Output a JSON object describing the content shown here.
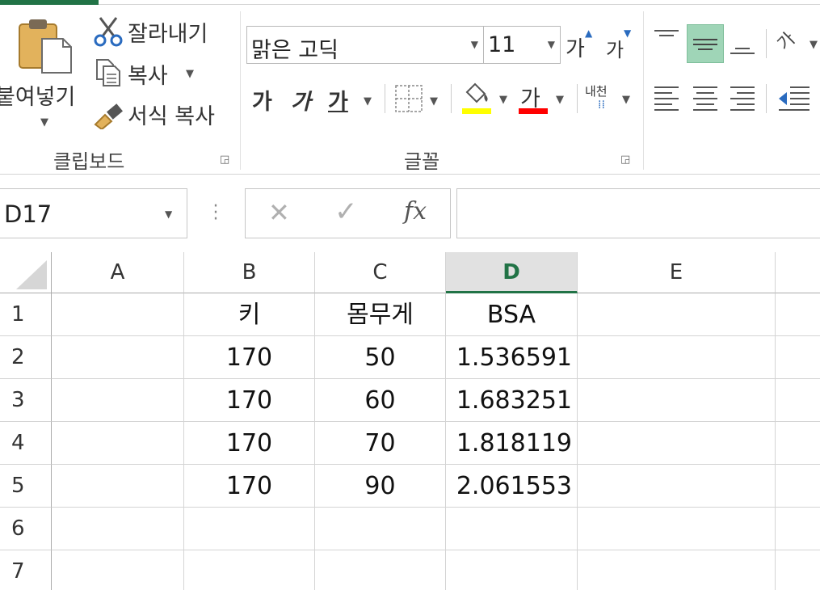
{
  "ribbon": {
    "clipboard": {
      "paste_label": "붙여넣기",
      "cut_label": "잘라내기",
      "copy_label": "복사",
      "format_painter_label": "서식 복사",
      "group_label": "클립보드"
    },
    "font": {
      "font_name": "맑은 고딕",
      "font_size": "11",
      "grow_label": "가",
      "shrink_label": "가",
      "bold_label": "가",
      "italic_label": "가",
      "underline_label": "가",
      "font_color_label": "가",
      "phonetic_label": "내천",
      "group_label": "글꼴",
      "fill_color": "#ffff00",
      "font_color": "#ff0000"
    }
  },
  "formula_bar": {
    "name_box": "D17",
    "fx_label": "fx",
    "formula": ""
  },
  "sheet": {
    "corner": "",
    "columns": [
      "A",
      "B",
      "C",
      "D",
      "E"
    ],
    "selected_column": "D",
    "rows": [
      {
        "num": "1",
        "cells": [
          "",
          "키",
          "몸무게",
          "BSA",
          ""
        ]
      },
      {
        "num": "2",
        "cells": [
          "",
          "170",
          "50",
          "1.536591",
          ""
        ]
      },
      {
        "num": "3",
        "cells": [
          "",
          "170",
          "60",
          "1.683251",
          ""
        ]
      },
      {
        "num": "4",
        "cells": [
          "",
          "170",
          "70",
          "1.818119",
          ""
        ]
      },
      {
        "num": "5",
        "cells": [
          "",
          "170",
          "90",
          "2.061553",
          ""
        ]
      },
      {
        "num": "6",
        "cells": [
          "",
          "",
          "",
          "",
          ""
        ]
      },
      {
        "num": "7",
        "cells": [
          "",
          "",
          "",
          "",
          ""
        ]
      }
    ]
  },
  "colors": {
    "excel_green": "#217346",
    "align_active": "#9fd5b7"
  }
}
